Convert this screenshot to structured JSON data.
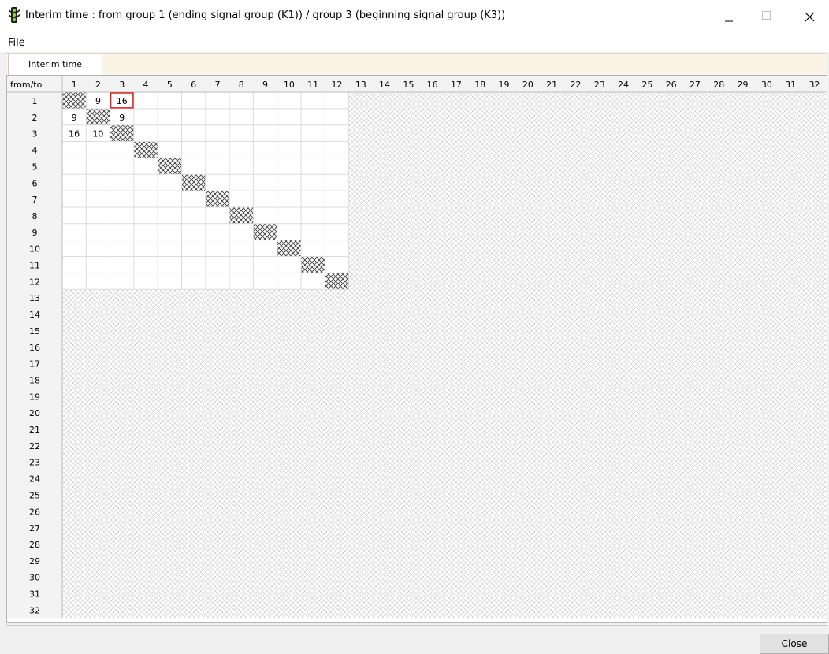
{
  "window": {
    "title": "Interim time :  from group  1 (ending signal group (K1)) / group  3 (beginning signal group (K3))",
    "app_icon": "traffic-light-icon"
  },
  "menu": {
    "file_label": "File"
  },
  "tabs": [
    {
      "label": "Interim time",
      "active": true
    }
  ],
  "grid": {
    "corner_label": "from/to",
    "size": 32,
    "active_size": 12,
    "columns": [
      "1",
      "2",
      "3",
      "4",
      "5",
      "6",
      "7",
      "8",
      "9",
      "10",
      "11",
      "12",
      "13",
      "14",
      "15",
      "16",
      "17",
      "18",
      "19",
      "20",
      "21",
      "22",
      "23",
      "24",
      "25",
      "26",
      "27",
      "28",
      "29",
      "30",
      "31",
      "32"
    ],
    "rows": [
      "1",
      "2",
      "3",
      "4",
      "5",
      "6",
      "7",
      "8",
      "9",
      "10",
      "11",
      "12",
      "13",
      "14",
      "15",
      "16",
      "17",
      "18",
      "19",
      "20",
      "21",
      "22",
      "23",
      "24",
      "25",
      "26",
      "27",
      "28",
      "29",
      "30",
      "31",
      "32"
    ],
    "cells": [
      {
        "row": 1,
        "col": 2,
        "value": "9"
      },
      {
        "row": 1,
        "col": 3,
        "value": "16",
        "selected": true
      },
      {
        "row": 2,
        "col": 1,
        "value": "9"
      },
      {
        "row": 2,
        "col": 3,
        "value": "9"
      },
      {
        "row": 3,
        "col": 1,
        "value": "16"
      },
      {
        "row": 3,
        "col": 2,
        "value": "10"
      }
    ],
    "colors": {
      "header_bg": "#f3f3f3",
      "grid_line": "#dcdcdc",
      "disabled_hatch": "#c8c8c8",
      "diagonal_hatch": "#3a3a3a",
      "selected_border": "#e02020"
    }
  },
  "footer": {
    "close_label": "Close"
  }
}
